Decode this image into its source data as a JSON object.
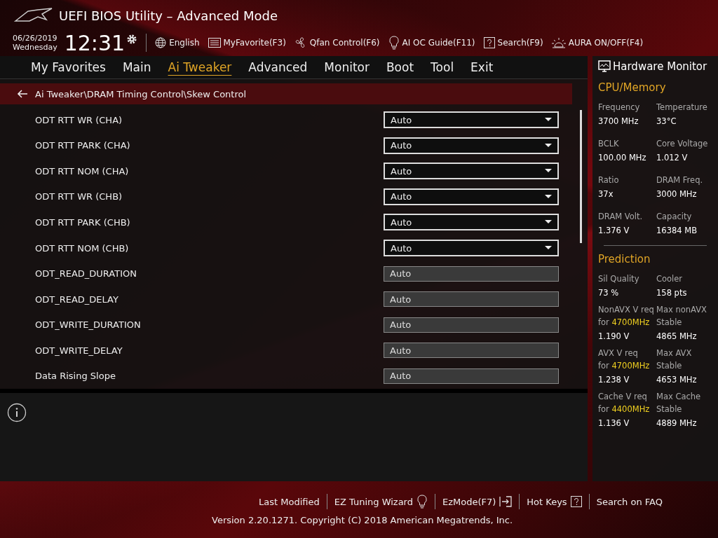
{
  "window": {
    "title": "UEFI BIOS Utility – Advanced Mode"
  },
  "clock": {
    "date": "06/26/2019",
    "weekday": "Wednesday",
    "time": "12:31"
  },
  "toolbar": [
    {
      "kind": "globe",
      "label": "English"
    },
    {
      "kind": "list",
      "label": "MyFavorite(F3)"
    },
    {
      "kind": "fan",
      "label": "Qfan Control(F6)"
    },
    {
      "kind": "bulb",
      "label": "AI OC Guide(F11)"
    },
    {
      "kind": "help",
      "label": "Search(F9)"
    },
    {
      "kind": "aura",
      "label": "AURA ON/OFF(F4)"
    }
  ],
  "tabs": [
    {
      "label": "My Favorites",
      "selected": false
    },
    {
      "label": "Main",
      "selected": false
    },
    {
      "label": "Ai Tweaker",
      "selected": true
    },
    {
      "label": "Advanced",
      "selected": false
    },
    {
      "label": "Monitor",
      "selected": false
    },
    {
      "label": "Boot",
      "selected": false
    },
    {
      "label": "Tool",
      "selected": false
    },
    {
      "label": "Exit",
      "selected": false
    }
  ],
  "breadcrumb": "Ai Tweaker\\DRAM Timing Control\\Skew Control",
  "settings": [
    {
      "label": "ODT RTT WR (CHA)",
      "value": "Auto",
      "kind": "dropdown"
    },
    {
      "label": "ODT RTT PARK (CHA)",
      "value": "Auto",
      "kind": "dropdown"
    },
    {
      "label": "ODT RTT NOM (CHA)",
      "value": "Auto",
      "kind": "dropdown"
    },
    {
      "label": "ODT RTT WR (CHB)",
      "value": "Auto",
      "kind": "dropdown"
    },
    {
      "label": "ODT RTT PARK (CHB)",
      "value": "Auto",
      "kind": "dropdown"
    },
    {
      "label": "ODT RTT NOM (CHB)",
      "value": "Auto",
      "kind": "dropdown"
    },
    {
      "label": "ODT_READ_DURATION",
      "value": "Auto",
      "kind": "input"
    },
    {
      "label": "ODT_READ_DELAY",
      "value": "Auto",
      "kind": "input"
    },
    {
      "label": "ODT_WRITE_DURATION",
      "value": "Auto",
      "kind": "input"
    },
    {
      "label": "ODT_WRITE_DELAY",
      "value": "Auto",
      "kind": "input"
    },
    {
      "label": "Data Rising Slope",
      "value": "Auto",
      "kind": "input"
    }
  ],
  "hardware_monitor": {
    "title": "Hardware Monitor",
    "sections": [
      {
        "title": "CPU/Memory",
        "items": [
          {
            "label": "Frequency",
            "value": "3700 MHz"
          },
          {
            "label": "Temperature",
            "value": "33°C"
          },
          {
            "label": "BCLK",
            "value": "100.00 MHz"
          },
          {
            "label": "Core Voltage",
            "value": "1.012 V"
          },
          {
            "label": "Ratio",
            "value": "37x"
          },
          {
            "label": "DRAM Freq.",
            "value": "3000 MHz"
          },
          {
            "label": "DRAM Volt.",
            "value": "1.376 V"
          },
          {
            "label": "Capacity",
            "value": "16384 MB"
          }
        ]
      },
      {
        "title": "Prediction",
        "items": [
          {
            "label": "Sil Quality",
            "value": "73 %"
          },
          {
            "label": "Cooler",
            "value": "158 pts"
          },
          {
            "label": "NonAVX V req",
            "sub": "for",
            "freq": "4700MHz",
            "value": "1.190 V"
          },
          {
            "label": "Max nonAVX",
            "sub": "Stable",
            "value": "4865 MHz"
          },
          {
            "label": "AVX V req",
            "sub": "for",
            "freq": "4700MHz",
            "value": "1.238 V"
          },
          {
            "label": "Max AVX",
            "sub": "Stable",
            "value": "4653 MHz"
          },
          {
            "label": "Cache V req",
            "sub": "for",
            "freq": "4400MHz",
            "value": "1.136 V"
          },
          {
            "label": "Max Cache",
            "sub": "Stable",
            "value": "4889 MHz"
          }
        ]
      }
    ]
  },
  "footer": {
    "links": [
      {
        "kind": "plain",
        "label": "Last Modified"
      },
      {
        "kind": "bulb",
        "label": "EZ Tuning Wizard"
      },
      {
        "kind": "exit",
        "label": "EzMode(F7)"
      },
      {
        "kind": "help",
        "label": "Hot Keys"
      },
      {
        "kind": "plain",
        "label": "Search on FAQ"
      }
    ],
    "version": "Version 2.20.1271. Copyright (C) 2018 American Megatrends, Inc."
  }
}
